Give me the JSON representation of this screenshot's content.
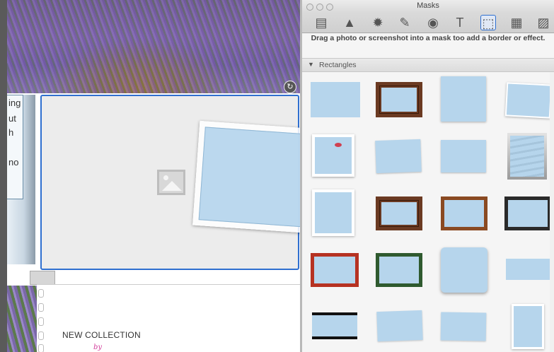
{
  "canvas": {
    "text_fragments": [
      "ing",
      "ut",
      "h",
      "no"
    ],
    "bottom_title": "NEW COLLECTION",
    "bottom_by": "by"
  },
  "masks_panel": {
    "title": "Masks",
    "toolbar_tools": [
      {
        "icon": "layout-icon",
        "glyph": "▤"
      },
      {
        "icon": "triangle-icon",
        "glyph": "▲"
      },
      {
        "icon": "starburst-icon",
        "glyph": "✹"
      },
      {
        "icon": "pin-icon",
        "glyph": "✎"
      },
      {
        "icon": "media-icon",
        "glyph": "◉"
      },
      {
        "icon": "text-icon",
        "glyph": "T"
      },
      {
        "icon": "mask-selection-icon",
        "glyph": "⬚"
      },
      {
        "icon": "pattern-icon",
        "glyph": "▦"
      },
      {
        "icon": "picture-icon",
        "glyph": "▨"
      }
    ],
    "active_tool": "mask-selection-icon",
    "hint": "Drag a photo or screenshot into a mask too add a border or effect.",
    "section_label": "Rectangles",
    "section_expanded": true
  },
  "colors": {
    "selection_blue": "#2f6fd0",
    "mask_sky": "#b6d5ec",
    "pink_accent": "#d23b9a"
  }
}
